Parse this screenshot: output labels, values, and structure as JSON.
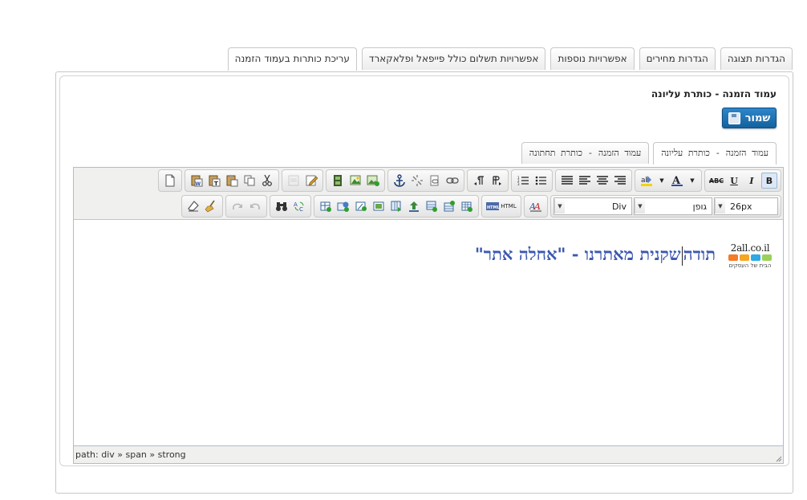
{
  "top_tabs": [
    {
      "label": "הגדרות תצוגה",
      "active": false
    },
    {
      "label": "הגדרות מחירים",
      "active": false
    },
    {
      "label": "אפשרויות נוספות",
      "active": false
    },
    {
      "label": "אפשרויות תשלום כולל פייפאל ופלאקארד",
      "active": false
    },
    {
      "label": "עריכת כותרות בעמוד הזמנה",
      "active": true
    }
  ],
  "page": {
    "heading": "עמוד הזמנה - כותרת עליונה",
    "save_label": "שמור"
  },
  "sub_tabs": [
    {
      "label": "עמוד הזמנה - כותרת עליונה",
      "active": true
    },
    {
      "label": "עמוד הזמנה - כותרת תחתונה",
      "active": false
    }
  ],
  "editor": {
    "font_size": "26px",
    "font_family": "גופן",
    "format": "Div",
    "html_label": "HTML",
    "bold_label": "B",
    "italic_label": "I",
    "underline_label": "U",
    "strike_label": "ABC",
    "content": {
      "before_caret": "תודה",
      "after_caret": "שקנית מאתרנו - \"אחלה אתר\""
    },
    "logo": {
      "text": "2all.co.il",
      "tagline": "הבית של העסקים",
      "colors": [
        "#9bd15a",
        "#2fa9e3",
        "#f5a623",
        "#f37b2a"
      ]
    },
    "status_path": "path: div » span » strong"
  },
  "colors": {
    "accent": "#1f74b6",
    "editor_text": "#3b58b0",
    "toolbar_bg": "#f0f0ee"
  }
}
